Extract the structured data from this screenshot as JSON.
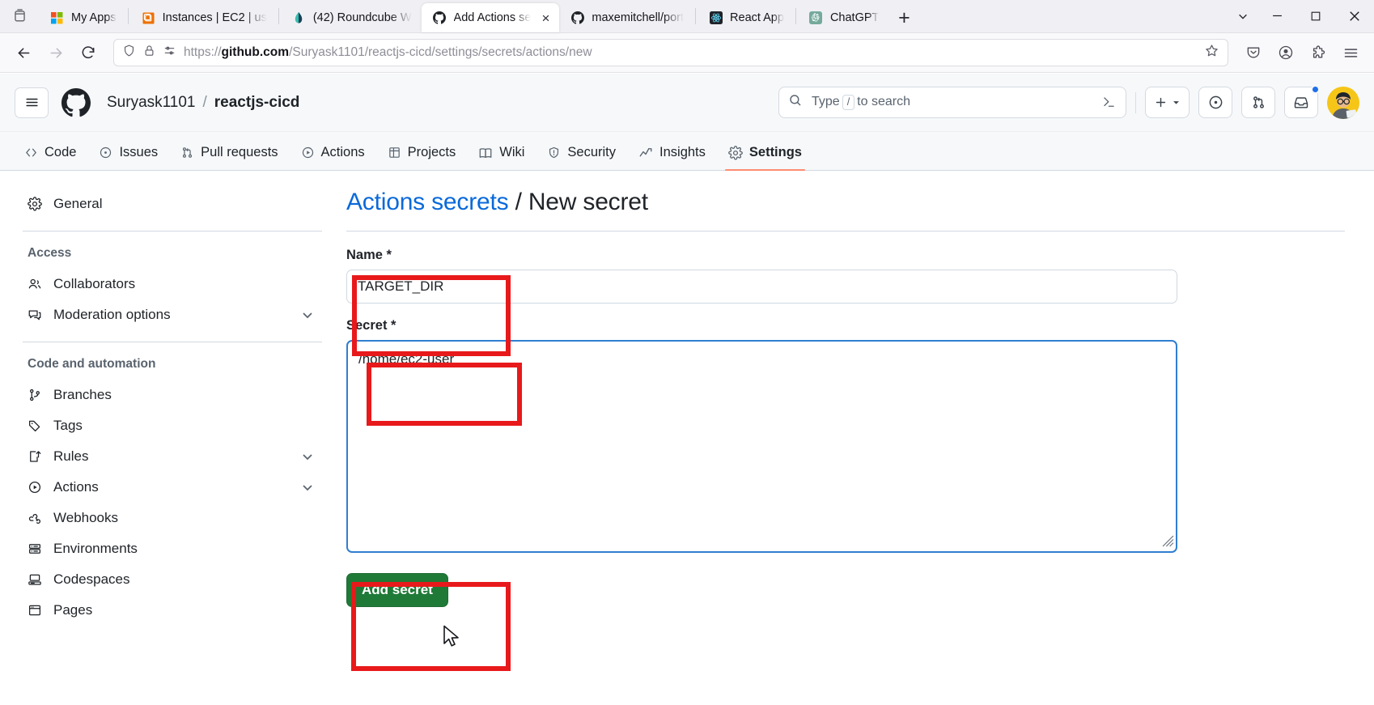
{
  "browser": {
    "sidebar_icon": "firefox-sidebar-icon",
    "tabs": [
      {
        "title": "My Apps",
        "favicon": "microsoft-logo-icon",
        "active": false
      },
      {
        "title": "Instances | EC2 | us",
        "favicon": "aws-ec2-icon",
        "active": false
      },
      {
        "title": "(42) Roundcube W",
        "favicon": "roundcube-icon",
        "active": false
      },
      {
        "title": "Add Actions se",
        "favicon": "github-icon",
        "active": true
      },
      {
        "title": "maxemitchell/port",
        "favicon": "github-icon",
        "active": false
      },
      {
        "title": "React App",
        "favicon": "react-icon",
        "active": false
      },
      {
        "title": "ChatGPT",
        "favicon": "openai-icon",
        "active": false
      }
    ],
    "new_tab_label": "+",
    "tab_close_label": "×",
    "window_controls": {
      "minimize": "—",
      "maximize": "□",
      "close": "✕"
    },
    "url": {
      "scheme": "https://",
      "host": "github.com",
      "path": "/Suryask1101/reactjs-cicd/settings/secrets/actions/new",
      "full": "https://github.com/Suryask1101/reactjs-cicd/settings/secrets/actions/new"
    },
    "nav_icons": [
      "back-arrow-icon",
      "forward-arrow-icon",
      "reload-icon"
    ],
    "urlbar_icons": [
      "shield-icon",
      "lock-icon",
      "permissions-icon",
      "bookmark-star-icon"
    ],
    "toolbar_icons": [
      "pocket-save-icon",
      "account-icon",
      "extensions-puzzle-icon",
      "app-menu-icon"
    ]
  },
  "github": {
    "hamburger_icon": "hamburger-menu-icon",
    "logo_icon": "github-mark-icon",
    "owner": "Suryask1101",
    "separator": "/",
    "repo": "reactjs-cicd",
    "search": {
      "placeholder_prefix": "Type",
      "slash_key": "/",
      "placeholder_suffix": "to search",
      "command_icon": "terminal-prompt-icon"
    },
    "header_actions": [
      {
        "name": "create-new-menu",
        "icon": "plus-icon",
        "caret": true
      },
      {
        "name": "issues-button",
        "icon": "issue-opened-icon"
      },
      {
        "name": "pull-requests-button",
        "icon": "git-pull-request-icon"
      },
      {
        "name": "notifications-button",
        "icon": "inbox-icon",
        "dot": true
      }
    ],
    "avatar": "user-avatar",
    "repo_tabs": [
      {
        "label": "Code",
        "icon": "code-icon",
        "active": false
      },
      {
        "label": "Issues",
        "icon": "issue-opened-icon",
        "active": false
      },
      {
        "label": "Pull requests",
        "icon": "git-pull-request-icon",
        "active": false
      },
      {
        "label": "Actions",
        "icon": "play-circle-icon",
        "active": false
      },
      {
        "label": "Projects",
        "icon": "table-icon",
        "active": false
      },
      {
        "label": "Wiki",
        "icon": "book-icon",
        "active": false
      },
      {
        "label": "Security",
        "icon": "shield-icon",
        "active": false
      },
      {
        "label": "Insights",
        "icon": "graph-icon",
        "active": false
      },
      {
        "label": "Settings",
        "icon": "gear-icon",
        "active": true
      }
    ],
    "sidebar": {
      "general": {
        "label": "General",
        "icon": "gear-icon"
      },
      "groups": [
        {
          "title": "Access",
          "items": [
            {
              "label": "Collaborators",
              "icon": "people-icon",
              "chevron": false
            },
            {
              "label": "Moderation options",
              "icon": "comment-discussion-icon",
              "chevron": true
            }
          ]
        },
        {
          "title": "Code and automation",
          "items": [
            {
              "label": "Branches",
              "icon": "git-branch-icon",
              "chevron": false
            },
            {
              "label": "Tags",
              "icon": "tag-icon",
              "chevron": false
            },
            {
              "label": "Rules",
              "icon": "rules-icon",
              "chevron": true
            },
            {
              "label": "Actions",
              "icon": "play-circle-icon",
              "chevron": true
            },
            {
              "label": "Webhooks",
              "icon": "webhook-icon",
              "chevron": false
            },
            {
              "label": "Environments",
              "icon": "server-icon",
              "chevron": false
            },
            {
              "label": "Codespaces",
              "icon": "codespaces-icon",
              "chevron": false
            },
            {
              "label": "Pages",
              "icon": "browser-window-icon",
              "chevron": false
            }
          ]
        }
      ]
    },
    "main": {
      "title_link": "Actions secrets",
      "title_sep": "/",
      "title_current": "New secret",
      "name_field": {
        "label": "Name *",
        "value": "TARGET_DIR",
        "placeholder": ""
      },
      "secret_field": {
        "label": "Secret *",
        "value": "/home/ec2-user",
        "placeholder": ""
      },
      "submit_label": "Add secret"
    }
  },
  "annotations": {
    "color": "#e8191b",
    "boxes": [
      {
        "name": "name-field-highlight"
      },
      {
        "name": "secret-field-highlight"
      },
      {
        "name": "add-secret-button-highlight"
      }
    ]
  },
  "colors": {
    "accent_blue": "#0969da",
    "green_button": "#1f7a37",
    "annotation_red": "#e8191b",
    "focus_border": "#2f7fd0",
    "gh_header_bg": "#f6f8fa"
  }
}
